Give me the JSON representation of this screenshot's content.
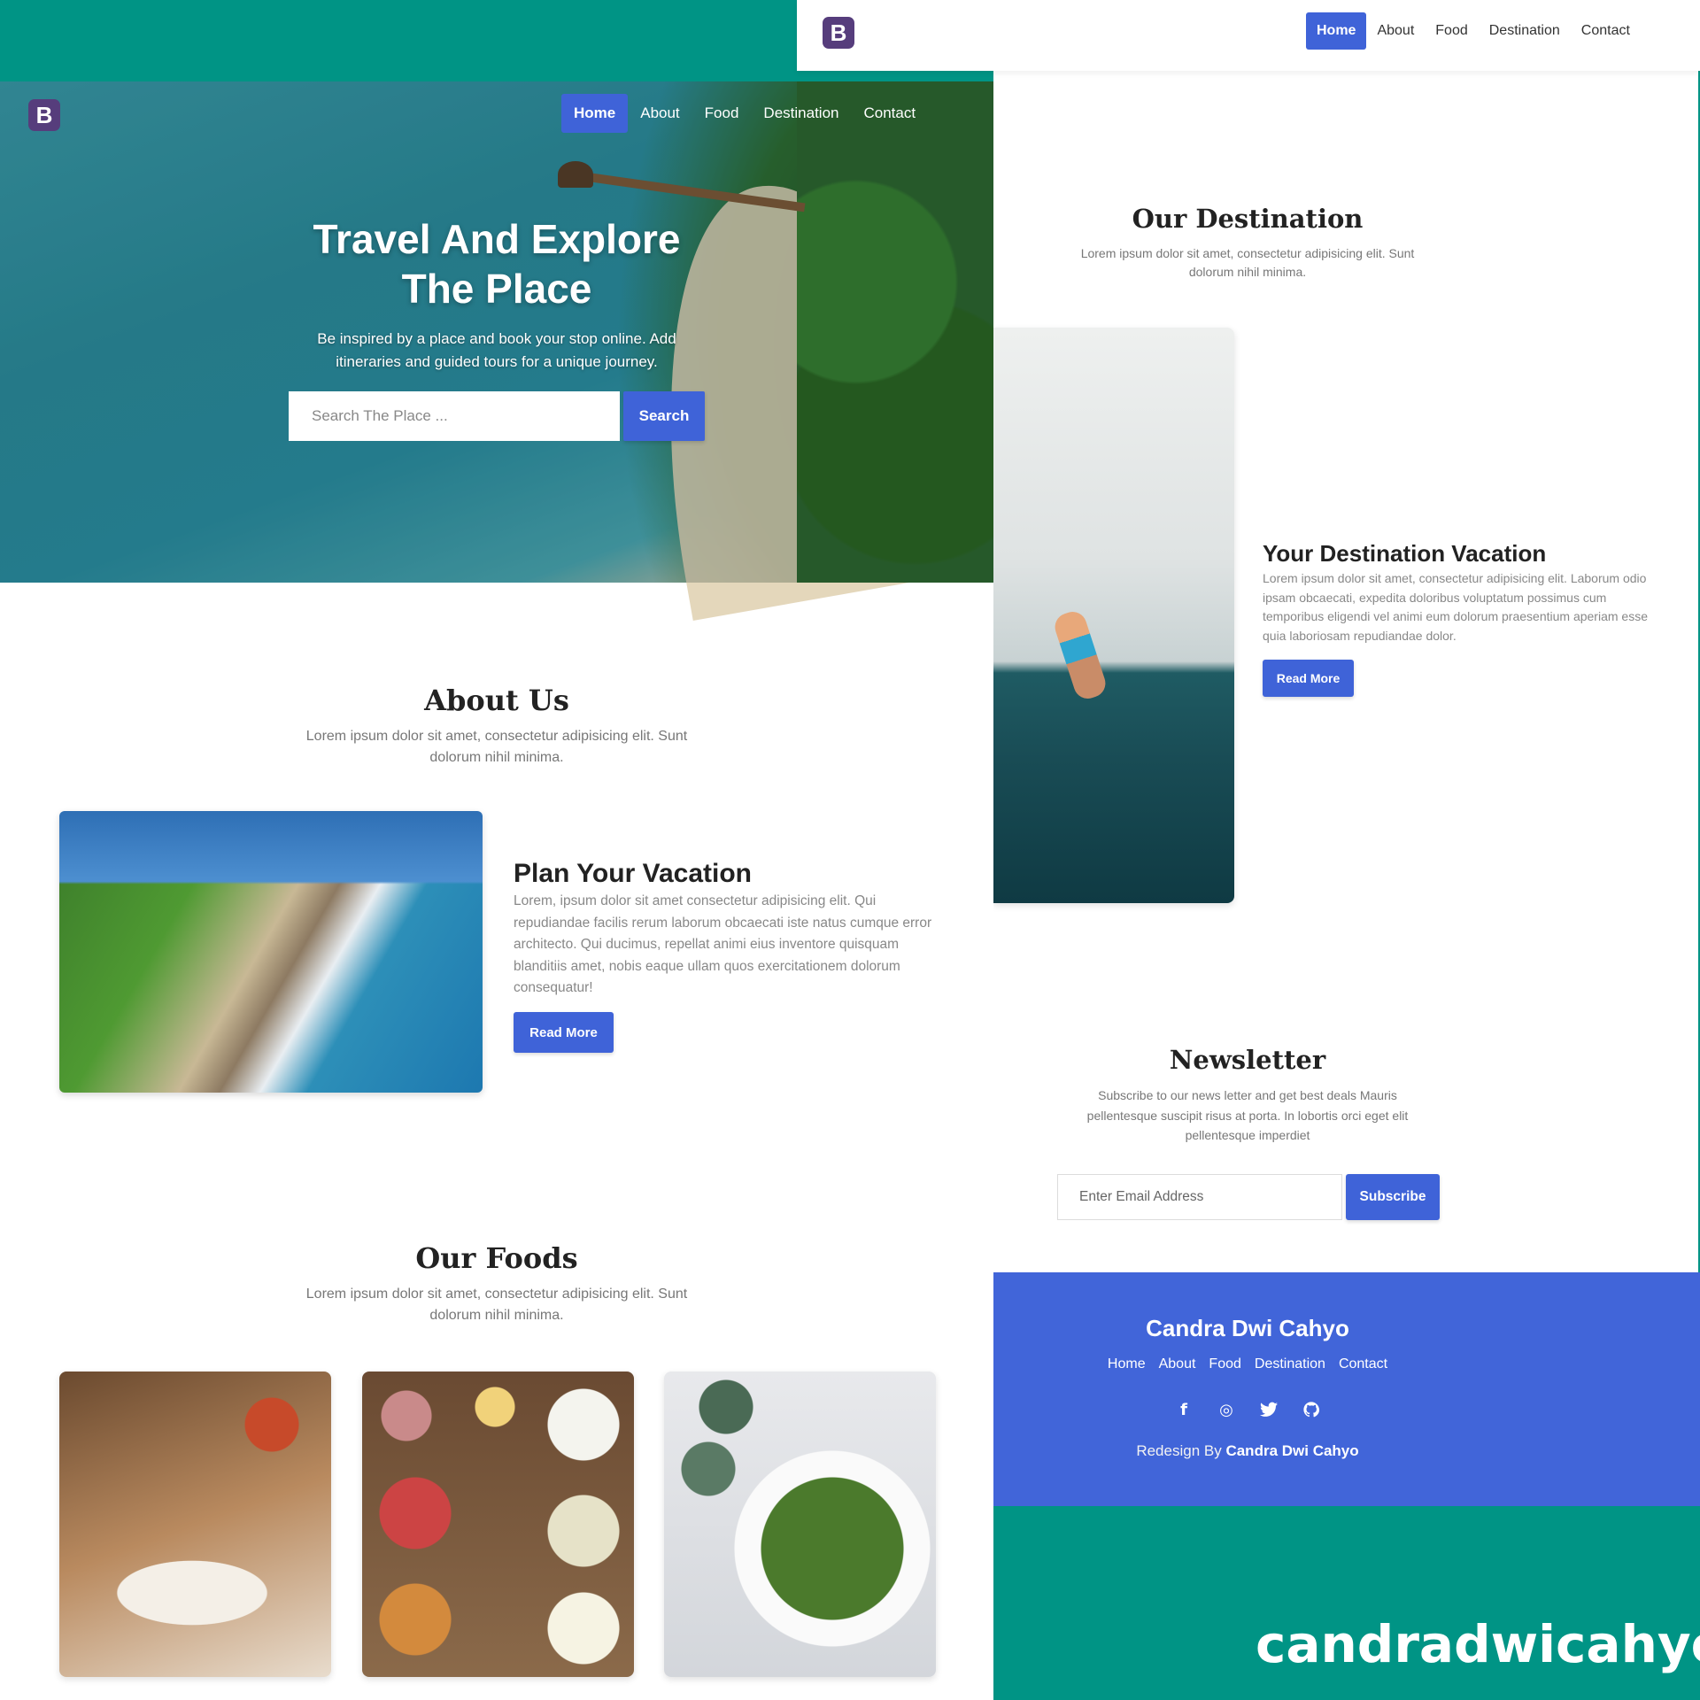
{
  "brand": {
    "logo_letter": "B"
  },
  "nav": {
    "items": [
      {
        "label": "Home",
        "active": true
      },
      {
        "label": "About"
      },
      {
        "label": "Food"
      },
      {
        "label": "Destination"
      },
      {
        "label": "Contact"
      }
    ]
  },
  "hero": {
    "title": "Travel And Explore The Place",
    "subtitle": "Be inspired by a place and book your stop online. Add itineraries and guided tours for a unique journey.",
    "search_placeholder": "Search The Place ...",
    "search_button": "Search"
  },
  "about": {
    "title": "About Us",
    "subtitle": "Lorem ipsum dolor sit amet, consectetur adipisicing elit. Sunt dolorum nihil minima.",
    "card": {
      "heading": "Plan Your Vacation",
      "text": "Lorem, ipsum dolor sit amet consectetur adipisicing elit. Qui repudiandae facilis rerum laborum obcaecati iste natus cumque error architecto. Qui ducimus, repellat animi eius inventore quisquam blanditiis amet, nobis eaque ullam quos exercitationem dolorum consequatur!",
      "button": "Read More"
    }
  },
  "foods": {
    "title": "Our Foods",
    "subtitle": "Lorem ipsum dolor sit amet, consectetur adipisicing elit. Sunt dolorum nihil minima."
  },
  "destination": {
    "title": "Our Destination",
    "subtitle": "Lorem ipsum dolor sit amet, consectetur adipisicing elit. Sunt dolorum nihil minima.",
    "card": {
      "heading": "Your Destination Vacation",
      "text": "Lorem ipsum dolor sit amet, consectetur adipisicing elit. Laborum odio ipsam obcaecati, expedita doloribus voluptatum possimus cum temporibus eligendi vel animi eum dolorum praesentium aperiam esse quia laboriosam repudiandae dolor.",
      "button": "Read More"
    }
  },
  "newsletter": {
    "title": "Newsletter",
    "subtitle": "Subscribe to our news letter and get best deals Mauris pellentesque suscipit risus at porta. In lobortis orci eget elit pellentesque imperdiet",
    "email_placeholder": "Enter Email Address",
    "button": "Subscribe"
  },
  "footer": {
    "name": "Candra Dwi Cahyo",
    "links": [
      "Home",
      "About",
      "Food",
      "Destination",
      "Contact"
    ],
    "socials": [
      "f",
      "◎",
      "🐦",
      "⊙"
    ],
    "credit_prefix": "Redesign By",
    "credit_name": "Candra Dwi Cahyo"
  },
  "watermark": "candradwicahyo",
  "colors": {
    "teal_bg": "#009485",
    "primary": "#3f63d8",
    "footer_bg": "#4165d9",
    "logo": "#563d7c"
  }
}
